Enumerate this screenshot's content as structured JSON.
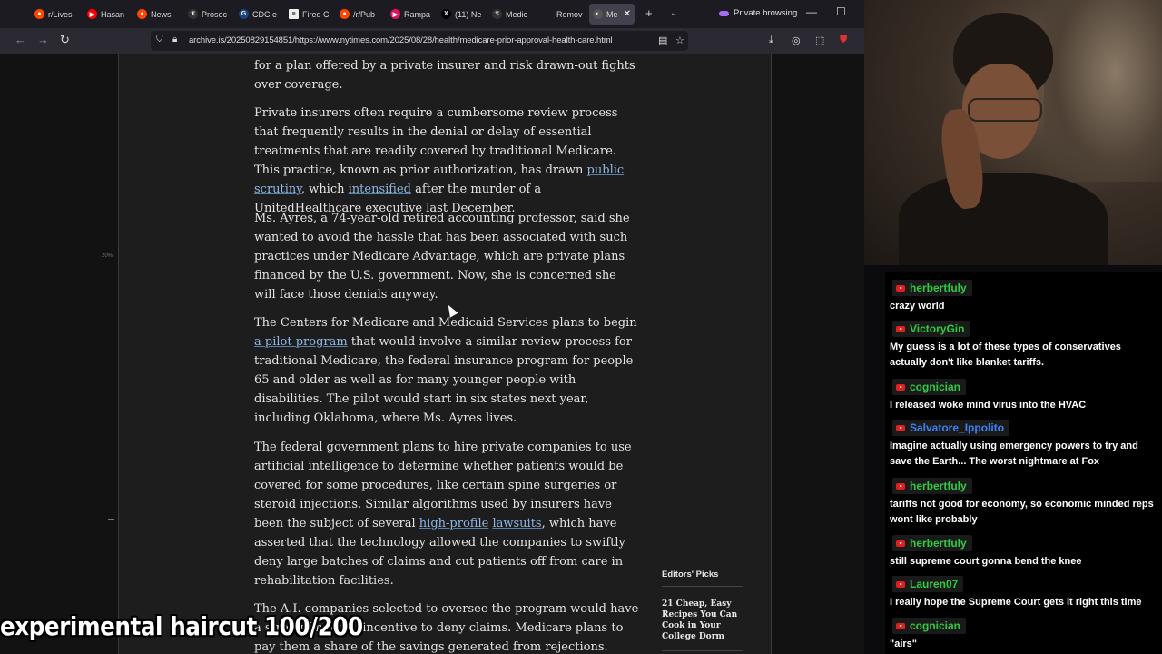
{
  "browser": {
    "tabs": [
      {
        "label": "r/Lives",
        "color": "#ff4500"
      },
      {
        "label": "Hasan",
        "color": "#ff0000"
      },
      {
        "label": "News",
        "color": "#ff4500"
      },
      {
        "label": "Prosec",
        "color": "#333333"
      },
      {
        "label": "CDC e",
        "color": "#1a4480"
      },
      {
        "label": "Fired C",
        "color": "#ffffff"
      },
      {
        "label": "/r/Pub",
        "color": "#ff4500"
      },
      {
        "label": "Rampa",
        "color": "#e0115f"
      },
      {
        "label": "(11) Ne",
        "color": "#000000"
      },
      {
        "label": "Medic",
        "color": "#333333"
      },
      {
        "label": "Remov",
        "color": "#1c1b22"
      },
      {
        "label": "Me",
        "color": "#555555",
        "active": true
      }
    ],
    "private_label": "Private browsing",
    "url": "archive.is/20250829154851/https://www.nytimes.com/2025/08/28/health/medicare-prior-approval-health-care.html",
    "icons": [
      "back-icon",
      "forward-icon",
      "reload-icon",
      "shield-icon",
      "lock-icon",
      "reader-icon",
      "star-icon",
      "download-icon",
      "account-icon",
      "extensions-icon",
      "ublock-icon"
    ]
  },
  "article": {
    "p0": "for a plan offered by a private insurer and risk drawn-out fights over coverage.",
    "p1_a": "Private insurers often require a cumbersome review process that frequently results in the denial or delay of essential treatments that are readily covered by traditional Medicare. This practice, known as prior authorization, has drawn ",
    "p1_link1": "public scrutiny",
    "p1_b": ", which ",
    "p1_link2": "intensified",
    "p1_c": " after the murder of a UnitedHealthcare executive last December.",
    "p2": "Ms. Ayres, a 74-year-old retired accounting professor, said she wanted to avoid the hassle that has been associated with such practices under Medicare Advantage, which are private plans financed by the U.S. government. Now, she is concerned she will face those denials anyway.",
    "p3_a": "The Centers for Medicare and Medicaid Services plans to begin ",
    "p3_link": "a pilot program",
    "p3_b": " that would involve a similar review process for traditional Medicare, the federal insurance program for people 65 and older as well as for many younger people with disabilities. The pilot would start in six states next year, including Oklahoma, where Ms. Ayres lives.",
    "p4_a": "The federal government plans to hire private companies to use artificial intelligence to determine whether patients would be covered for some procedures, like certain spine surgeries or steroid injections. Similar algorithms used by insurers have been the subject of several ",
    "p4_link1": "high-profile",
    "p4_b": " ",
    "p4_link2": "lawsuits",
    "p4_c": ", which have asserted that the technology allowed the companies to swiftly deny large batches of claims and cut patients off from care in rehabilitation facilities.",
    "p5": "The A.I. companies selected to oversee the program would have a strong financial incentive to deny claims. Medicare plans to pay them a share of the savings generated from rejections.",
    "scroll_pct": "20%",
    "editors_picks_title": "Editors' Picks",
    "editors_pick_1": "21 Cheap, Easy Recipes You Can Cook in Your College Dorm"
  },
  "overlay": {
    "caption": "experimental haircut 100/200"
  },
  "chat": {
    "messages": [
      {
        "user": "herbertfuly",
        "color": "#2ecc40",
        "text": "crazy world"
      },
      {
        "user": "VictoryGin",
        "color": "#2ecc40",
        "text": "My guess is a lot of these types of conservatives actually don't like blanket tariffs."
      },
      {
        "user": "cognician",
        "color": "#2ecc40",
        "text": "I released woke mind virus into the HVAC"
      },
      {
        "user": "Salvatore_Ippolito",
        "color": "#3b82f6",
        "text": "Imagine actually using emergency powers to try and save the Earth... The worst nightmare at Fox"
      },
      {
        "user": "herbertfuly",
        "color": "#2ecc40",
        "text": "tariffs not good for economy, so economic minded reps wont like probably"
      },
      {
        "user": "herbertfuly",
        "color": "#2ecc40",
        "text": "still supreme court gonna bend the knee"
      },
      {
        "user": "Lauren07",
        "color": "#2ecc40",
        "text": "I really hope the Supreme Court gets it right this time"
      },
      {
        "user": "cognician",
        "color": "#2ecc40",
        "text": "\"airs\""
      }
    ]
  }
}
